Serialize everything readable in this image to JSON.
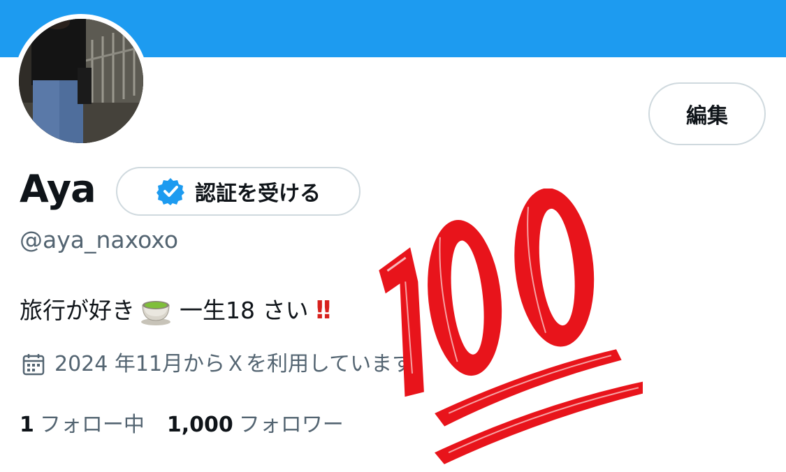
{
  "profile": {
    "name": "Aya",
    "handle": "@aya_naxoxo",
    "bio_text": "旅行が好き",
    "bio_suffix": "一生18 さい",
    "joined": "2024 年11月からＸを利用しています",
    "following_count": "1",
    "following_label": "フォロー中",
    "followers_count": "1,000",
    "followers_label": "フォロワー"
  },
  "buttons": {
    "edit_label": "編集",
    "verify_label": "認証を受ける"
  },
  "icons": {
    "verify": "verified-badge-icon",
    "tea": "teacup-emoji-icon",
    "exclamation": "double-exclamation-emoji-icon",
    "calendar": "calendar-icon",
    "sticker": "hundred-points-emoji-sticker"
  },
  "colors": {
    "banner": "#1d9bf0",
    "badge": "#1d9bf0",
    "text_primary": "#0f1419",
    "text_secondary": "#536471",
    "sticker_red": "#e8141b"
  }
}
